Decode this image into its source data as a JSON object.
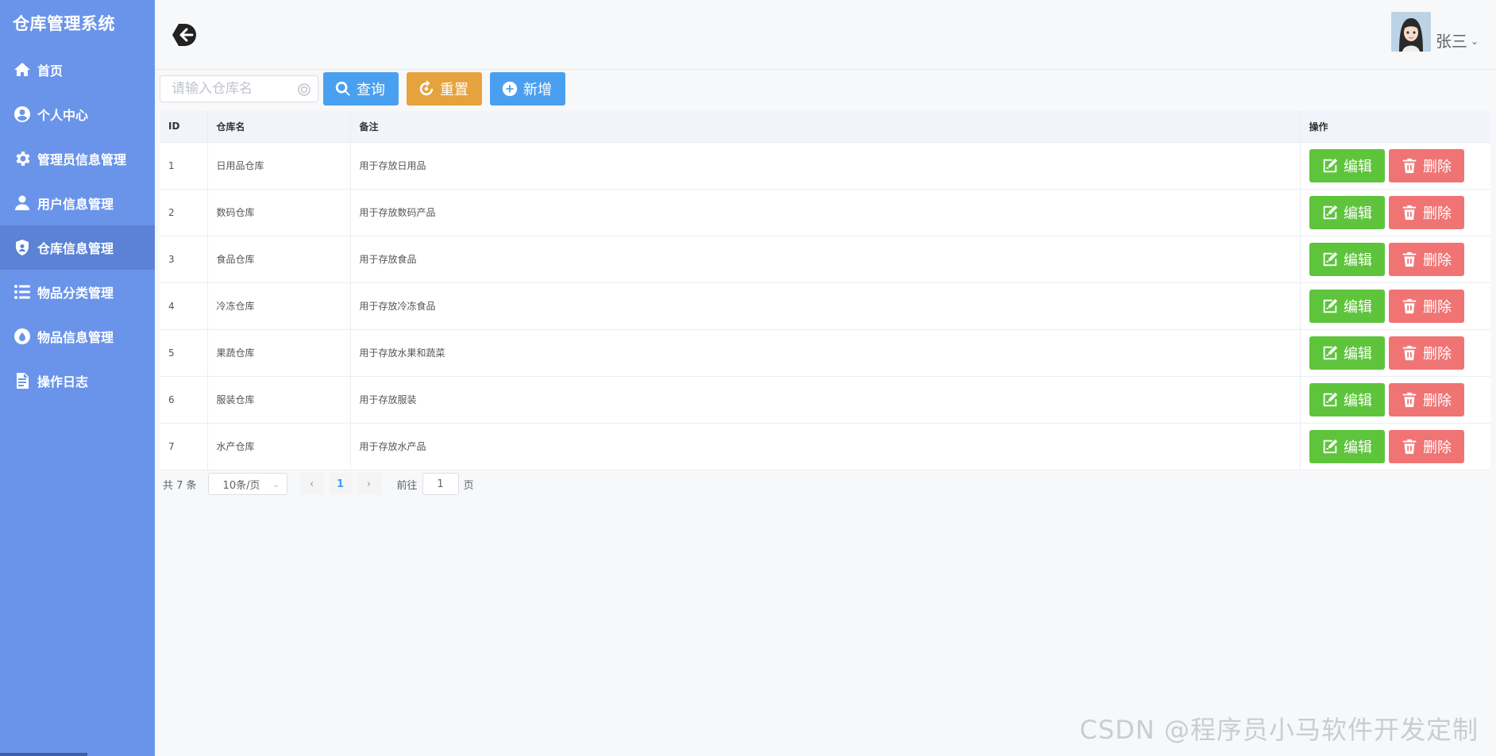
{
  "sidebar": {
    "title": "仓库管理系统",
    "items": [
      {
        "label": "首页",
        "icon": "home-icon"
      },
      {
        "label": "个人中心",
        "icon": "user-circle-icon"
      },
      {
        "label": "管理员信息管理",
        "icon": "gear-icon"
      },
      {
        "label": "用户信息管理",
        "icon": "user-icon"
      },
      {
        "label": "仓库信息管理",
        "icon": "shield-icon",
        "active": true
      },
      {
        "label": "物品分类管理",
        "icon": "list-icon"
      },
      {
        "label": "物品信息管理",
        "icon": "drop-icon"
      },
      {
        "label": "操作日志",
        "icon": "document-icon"
      }
    ]
  },
  "header": {
    "username": "张三"
  },
  "toolbar": {
    "search_placeholder": "请输入仓库名",
    "query_label": "查询",
    "reset_label": "重置",
    "add_label": "新增"
  },
  "table": {
    "columns": [
      "ID",
      "仓库名",
      "备注",
      "操作"
    ],
    "rows": [
      {
        "id": "1",
        "name": "日用品仓库",
        "note": "用于存放日用品"
      },
      {
        "id": "2",
        "name": "数码仓库",
        "note": "用于存放数码产品"
      },
      {
        "id": "3",
        "name": "食品仓库",
        "note": "用于存放食品"
      },
      {
        "id": "4",
        "name": "冷冻仓库",
        "note": "用于存放冷冻食品"
      },
      {
        "id": "5",
        "name": "果蔬仓库",
        "note": "用于存放水果和蔬菜"
      },
      {
        "id": "6",
        "name": "服装仓库",
        "note": "用于存放服装"
      },
      {
        "id": "7",
        "name": "水产仓库",
        "note": "用于存放水产品"
      }
    ],
    "edit_label": "编辑",
    "delete_label": "删除"
  },
  "pagination": {
    "total": "共 7 条",
    "page_size": "10条/页",
    "current_page": "1",
    "goto_label": "前往",
    "goto_value": "1",
    "goto_suffix": "页"
  },
  "watermark": "CSDN @程序员小马软件开发定制",
  "colors": {
    "sidebar": "#6a94ea",
    "sidebar_active": "#5b82d4",
    "primary": "#4aa0f0",
    "warning": "#e6a23c",
    "success": "#5ec43c",
    "danger": "#f07474"
  }
}
